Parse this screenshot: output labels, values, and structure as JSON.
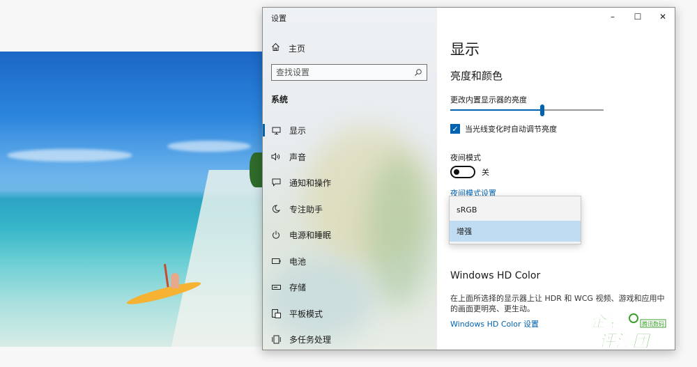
{
  "window": {
    "title": "设置",
    "controls": {
      "minimize": "–",
      "maximize": "☐",
      "close": "✕"
    }
  },
  "sidebar": {
    "home": {
      "icon": "home-icon",
      "label": "主页"
    },
    "search": {
      "placeholder": "查找设置",
      "icon": "search-icon"
    },
    "section": "系统",
    "items": [
      {
        "icon": "monitor-icon",
        "label": "显示",
        "selected": true
      },
      {
        "icon": "speaker-icon",
        "label": "声音",
        "selected": false
      },
      {
        "icon": "notification-icon",
        "label": "通知和操作",
        "selected": false
      },
      {
        "icon": "moon-icon",
        "label": "专注助手",
        "selected": false
      },
      {
        "icon": "power-icon",
        "label": "电源和睡眠",
        "selected": false
      },
      {
        "icon": "battery-icon",
        "label": "电池",
        "selected": false
      },
      {
        "icon": "storage-icon",
        "label": "存储",
        "selected": false
      },
      {
        "icon": "tablet-icon",
        "label": "平板模式",
        "selected": false
      },
      {
        "icon": "multitask-icon",
        "label": "多任务处理",
        "selected": false
      }
    ]
  },
  "main": {
    "title": "显示",
    "brightness_section": "亮度和颜色",
    "brightness_label": "更改内置显示器的亮度",
    "brightness_value": 0.6,
    "auto_brightness": {
      "label": "当光线变化时自动调节亮度",
      "checked": true
    },
    "night_mode": {
      "label": "夜间模式",
      "state_label": "关",
      "on": false
    },
    "night_settings_link": "夜间模式设置",
    "dropdown": {
      "options": [
        "sRGB",
        "增强"
      ],
      "selected": "增强"
    },
    "hdr": {
      "title": "Windows HD Color",
      "description": "在上面所选择的显示器上让 HDR 和 WCG 视频、游戏和应用中的画面更明亮、更生动。",
      "link": "Windows HD Color 设置"
    }
  },
  "watermark": {
    "text_top": "企鹅",
    "text_bottom": "评测团",
    "badge": "腾讯数码"
  },
  "colors": {
    "accent": "#0063b1",
    "dropdown_selected": "#bfdcf2",
    "watermark_green": "#3aa02a"
  }
}
